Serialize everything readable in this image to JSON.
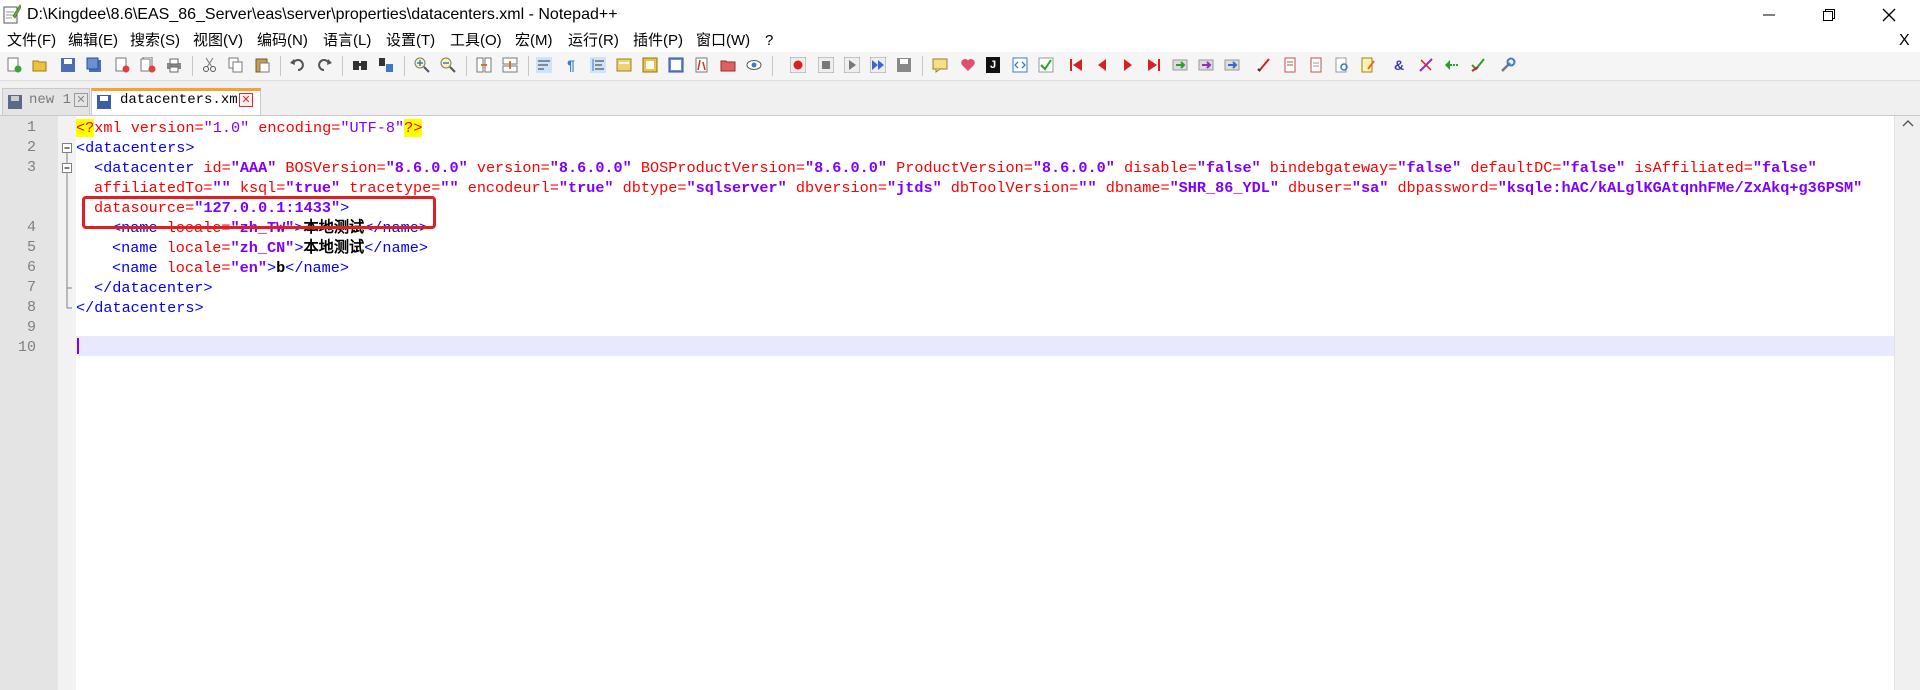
{
  "window": {
    "title": "D:\\Kingdee\\8.6\\EAS_86_Server\\eas\\server\\properties\\datacenters.xml - Notepad++"
  },
  "menu": {
    "items": [
      "文件(F)",
      "编辑(E)",
      "搜索(S)",
      "视图(V)",
      "编码(N)",
      "语言(L)",
      "设置(T)",
      "工具(O)",
      "宏(M)",
      "运行(R)",
      "插件(P)",
      "窗口(W)",
      "?"
    ],
    "close_label": "X"
  },
  "toolbar": {
    "icons": [
      "new-file-icon",
      "open-file-icon",
      "save-icon",
      "save-all-icon",
      "close-icon",
      "close-all-icon",
      "print-icon",
      "cut-icon",
      "copy-icon",
      "paste-icon",
      "undo-icon",
      "redo-icon",
      "find-icon",
      "replace-icon",
      "zoom-in-icon",
      "zoom-out-icon",
      "sync-v-icon",
      "sync-h-icon",
      "word-wrap-icon",
      "show-all-chars-icon",
      "indent-guide-icon",
      "udl-icon",
      "doc-map-icon",
      "function-list-icon",
      "folder-workspace-icon",
      "monitor-icon",
      "record-macro-icon",
      "stop-macro-icon",
      "play-macro-icon",
      "run-macro-multiple-icon",
      "save-macro-icon",
      "plugin-icons"
    ],
    "glyphs": {
      "ampersand": "&",
      "pilcrow": "¶",
      "j": "J"
    }
  },
  "tabs": [
    {
      "label": "new 1",
      "active": false
    },
    {
      "label": "datacenters.xml",
      "active": true
    }
  ],
  "editor": {
    "line_numbers": [
      "1",
      "2",
      "3",
      "",
      "",
      "4",
      "5",
      "6",
      "7",
      "8",
      "9",
      "10"
    ],
    "lines": {
      "l1": {
        "p1": "<?",
        "p2": "xml version=",
        "p3": "\"1.0\"",
        "p4": " encoding=",
        "p5": "\"UTF-8\"",
        "p6": "?>"
      },
      "l2": {
        "p1": "<datacenters>"
      },
      "l3": {
        "p1": "<datacenter",
        "p2": " id=",
        "p3": "\"AAA\"",
        "p4": " BOSVersion=",
        "p5": "\"8.6.0.0\"",
        "p6": " version=",
        "p7": "\"8.6.0.0\"",
        "p8": " BOSProductVersion=",
        "p9": "\"8.6.0.0\"",
        "p10": " ProductVersion=",
        "p11": "\"8.6.0.0\"",
        "p12": " disable=",
        "p13": "\"false\"",
        "p14": " bindebgateway=",
        "p15": "\"false\"",
        "p16": " defaultDC=",
        "p17": "\"false\"",
        "p18": " isAffiliated=",
        "p19": "\"false\""
      },
      "l3b": {
        "p1": "affiliatedTo=",
        "p2": "\"\"",
        "p3": " ksql=",
        "p4": "\"true\"",
        "p5": " tracetype=",
        "p6": "\"\"",
        "p7": " encodeurl=",
        "p8": "\"true\"",
        "p9": " dbtype=",
        "p10": "\"sqlserver\"",
        "p11": " dbversion=",
        "p12": "\"jtds\"",
        "p13": " dbToolVersion=",
        "p14": "\"\"",
        "p15": " dbname=",
        "p16": "\"SHR_86_YDL\"",
        "p17": " dbuser=",
        "p18": "\"sa\"",
        "p19": " dbpassword=",
        "p20": "\"ksqle:hAC/kALglKGAtqnhFMe/ZxAkq+g36PSM\""
      },
      "l3c": {
        "p1": "datasource=",
        "p2": "\"127.0.0.1:1433\"",
        "p3": ">"
      },
      "l4": {
        "p1": "<name",
        "p2": " locale=",
        "p3": "\"zh_TW\"",
        "p4": ">",
        "p5": "本地测试",
        "p6": "</name>"
      },
      "l5": {
        "p1": "<name",
        "p2": " locale=",
        "p3": "\"zh_CN\"",
        "p4": ">",
        "p5": "本地测试",
        "p6": "</name>"
      },
      "l6": {
        "p1": "<name",
        "p2": " locale=",
        "p3": "\"en\"",
        "p4": ">",
        "p5": "b",
        "p6": "</name>"
      },
      "l7": {
        "p1": "</datacenter>"
      },
      "l8": {
        "p1": "</datacenters>"
      }
    }
  },
  "colors": {
    "tag": "#0000ff",
    "attribute": "#ff0000",
    "value": "#8000ff",
    "annotation_box": "#e02020",
    "active_tab_accent": "#f6a038",
    "current_line": "#e8e8ff"
  }
}
